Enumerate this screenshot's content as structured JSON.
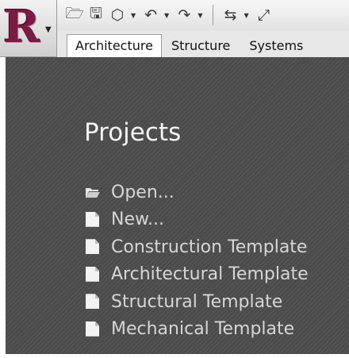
{
  "app": {
    "logo_letter": "R"
  },
  "quick_access": {
    "buttons": [
      {
        "icon": "open-folder-icon",
        "glyph": "🗁"
      },
      {
        "icon": "save-icon",
        "glyph": "🖫"
      },
      {
        "icon": "sync-icon",
        "glyph": "⬡"
      },
      {
        "icon": "undo-icon",
        "glyph": "↶"
      },
      {
        "icon": "redo-icon",
        "glyph": "↷"
      },
      {
        "icon": "measure-icon",
        "glyph": "⇆"
      },
      {
        "icon": "dimension-icon",
        "glyph": "⤢"
      }
    ]
  },
  "ribbon": {
    "tabs": [
      {
        "label": "Architecture",
        "active": true
      },
      {
        "label": "Structure",
        "active": false
      },
      {
        "label": "Systems",
        "active": false
      }
    ]
  },
  "projects": {
    "title": "Projects",
    "items": [
      {
        "label": "Open...",
        "icon": "open-folder-icon"
      },
      {
        "label": "New...",
        "icon": "document-icon"
      },
      {
        "label": "Construction Template",
        "icon": "document-icon"
      },
      {
        "label": "Architectural Template",
        "icon": "document-icon"
      },
      {
        "label": "Structural Template",
        "icon": "document-icon"
      },
      {
        "label": "Mechanical Template",
        "icon": "document-icon"
      }
    ]
  },
  "colors": {
    "panel_bg": "#4b4b4b",
    "panel_text": "#d6d6d6",
    "title_text": "#f4f4f4",
    "logo": "#7a1b44"
  }
}
